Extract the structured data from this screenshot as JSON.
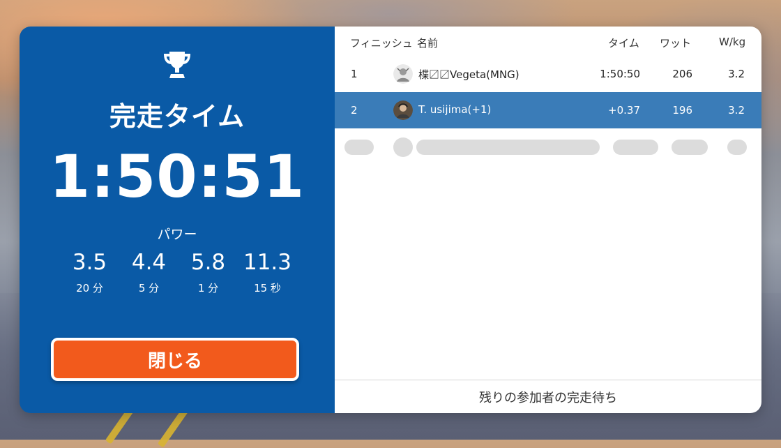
{
  "finish_panel": {
    "title": "完走タイム",
    "time": "1:50:51",
    "power_label": "パワー",
    "power_stats": [
      {
        "value": "3.5",
        "duration": "20 分"
      },
      {
        "value": "4.4",
        "duration": "5 分"
      },
      {
        "value": "5.8",
        "duration": "1 分"
      },
      {
        "value": "11.3",
        "duration": "15 秒"
      }
    ],
    "close_label": "閉じる"
  },
  "results": {
    "headers": {
      "finish": "フィニッシュ",
      "name": "名前",
      "time": "タイム",
      "watt": "ワット",
      "wkg": "W/kg"
    },
    "rows": [
      {
        "position": "1",
        "name": "楪〼〼Vegeta(MNG)",
        "time": "1:50:50",
        "watt": "206",
        "wkg": "3.2",
        "avatar": "rider-avatar-icon"
      },
      {
        "position": "2",
        "name": "T. usijima(+1)",
        "time": "+0.37",
        "watt": "196",
        "wkg": "3.2",
        "avatar": "rider-avatar-icon",
        "highlighted": true
      }
    ],
    "footer": "残りの参加者の完走待ち"
  },
  "colors": {
    "panel_blue": "#0a5aa6",
    "highlight_row": "#3a7cb8",
    "close_button": "#f25a1c"
  },
  "icons": [
    "trophy-icon",
    "rider-avatar-icon"
  ]
}
